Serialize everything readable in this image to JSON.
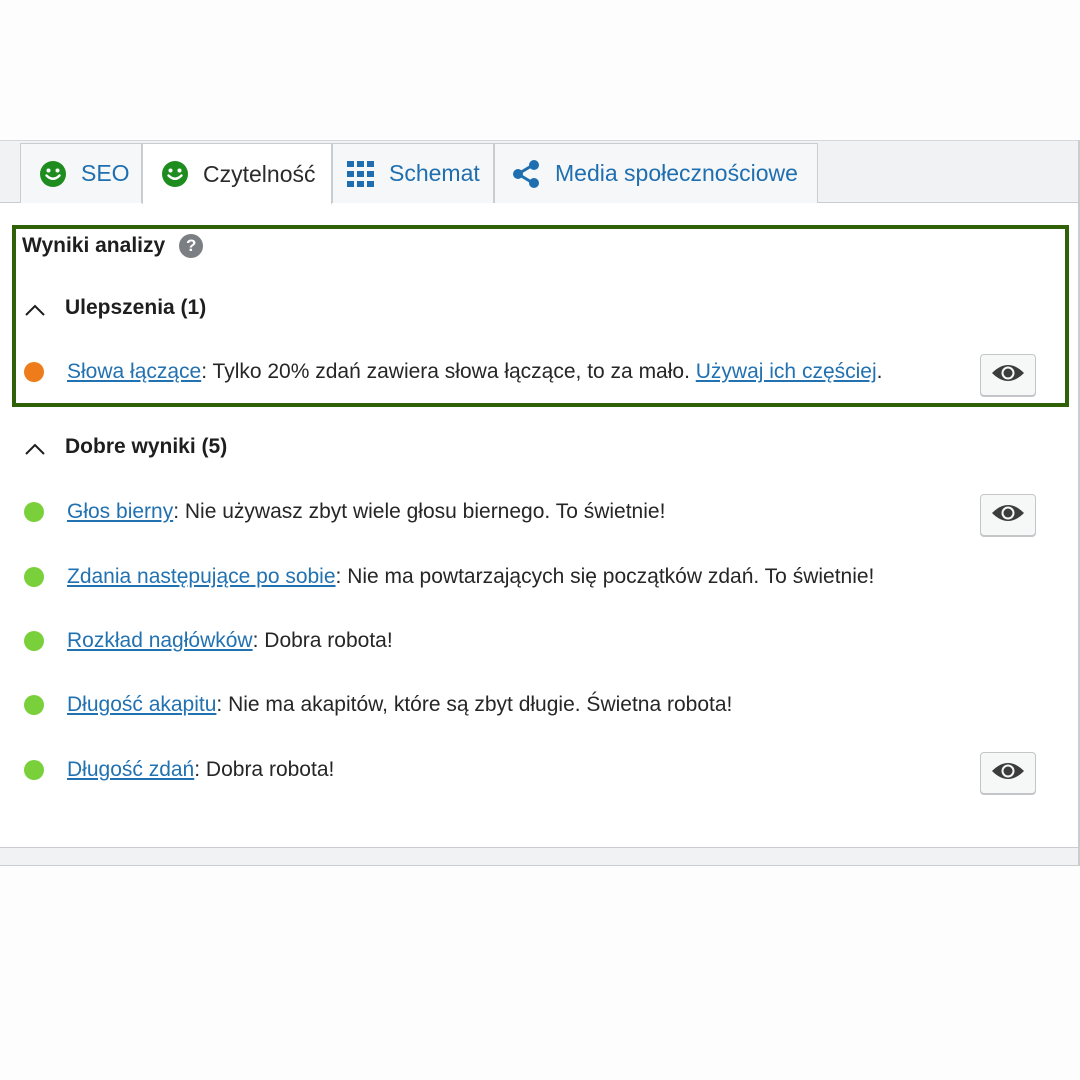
{
  "tabs": [
    {
      "label": "SEO",
      "icon": "smiley-green-icon"
    },
    {
      "label": "Czytelność",
      "icon": "smiley-green-icon"
    },
    {
      "label": "Schemat",
      "icon": "grid-icon"
    },
    {
      "label": "Media społecznościowe",
      "icon": "share-icon"
    }
  ],
  "analysis": {
    "title": "Wyniki analizy",
    "help_icon": "?"
  },
  "improvements": {
    "heading": "Ulepszenia (1)",
    "items": [
      {
        "link": "Słowa łączące",
        "text": ": Tylko 20% zdań zawiera słowa łączące, to za mało. ",
        "link2": "Używaj ich częściej",
        "suffix": ".",
        "status": "orange"
      }
    ]
  },
  "good": {
    "heading": "Dobre wyniki (5)",
    "items": [
      {
        "link": "Głos bierny",
        "text": ": Nie używasz zbyt wiele głosu biernego. To świetnie!"
      },
      {
        "link": "Zdania następujące po sobie",
        "text": ": Nie ma powtarzających się początków zdań. To świetnie!"
      },
      {
        "link": "Rozkład nagłówków",
        "text": ": Dobra robota!"
      },
      {
        "link": "Długość akapitu",
        "text": ": Nie ma akapitów, które są zbyt długie. Świetna robota!"
      },
      {
        "link": "Długość zdań",
        "text": ": Dobra robota!"
      }
    ]
  },
  "colors": {
    "orange": "#ee7c1b",
    "green": "#7ad03a",
    "link": "#2271b1",
    "highlight_border": "#2f6109",
    "smiley": "#1e8c1e"
  }
}
